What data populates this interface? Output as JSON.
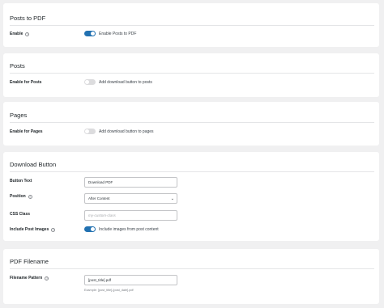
{
  "sections": {
    "posts_to_pdf": {
      "title": "Posts to PDF",
      "enable_label": "Enable",
      "enable_toggle_label": "Enable Posts to PDF",
      "enable_on": true
    },
    "posts": {
      "title": "Posts",
      "enable_label": "Enable for Posts",
      "toggle_label": "Add download button to posts",
      "enabled": false
    },
    "pages": {
      "title": "Pages",
      "enable_label": "Enable for Pages",
      "toggle_label": "Add download button to pages",
      "enabled": false
    },
    "download_button": {
      "title": "Download Button",
      "button_text_label": "Button Text",
      "button_text_value": "Download PDF",
      "position_label": "Position",
      "position_value": "After Content",
      "css_class_label": "CSS Class",
      "css_class_placeholder": "my-custom-class",
      "include_images_label": "Include Post Images",
      "include_images_toggle_label": "Include images from post content",
      "include_images_on": true
    },
    "pdf_filename": {
      "title": "PDF Filename",
      "pattern_label": "Filename Pattern",
      "pattern_value": "[post_title].pdf",
      "pattern_hint": "Example: [post_title]-[post_date].pdf"
    }
  },
  "colors": {
    "accent": "#2271b1",
    "toggle_off": "#dcdcde",
    "background": "#f0f0f1"
  }
}
